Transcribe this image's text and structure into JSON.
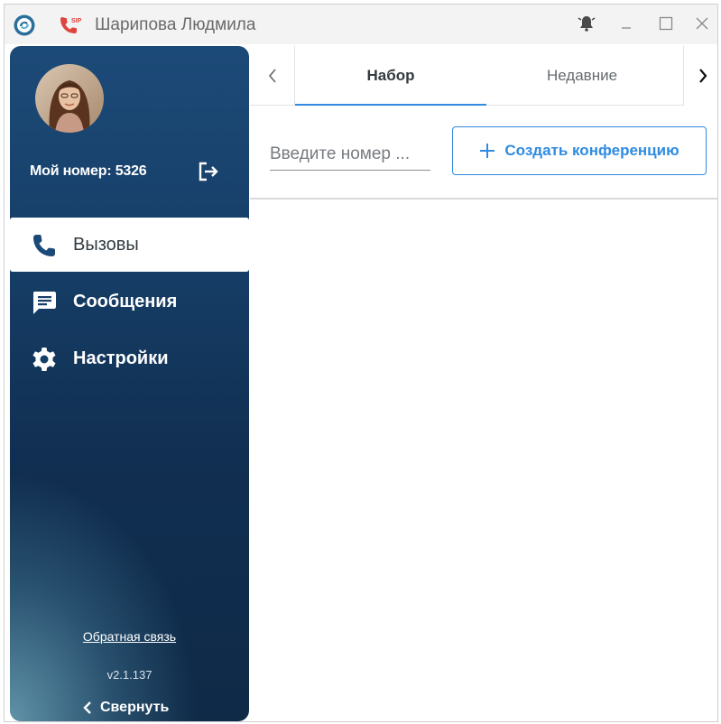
{
  "window": {
    "title": "Шарипова Людмила",
    "icons": [
      "app-logo-icon",
      "sip-phone-icon",
      "bell-icon",
      "minimize-icon",
      "maximize-icon",
      "close-icon"
    ]
  },
  "sidebar": {
    "my_number_label": "Мой номер: 5326",
    "items": [
      {
        "label": "Вызовы",
        "icon": "phone-icon",
        "active": true
      },
      {
        "label": "Сообщения",
        "icon": "message-icon",
        "active": false
      },
      {
        "label": "Настройки",
        "icon": "gear-icon",
        "active": false
      }
    ],
    "feedback_label": "Обратная связь",
    "version": "v2.1.137",
    "collapse_label": "Свернуть"
  },
  "tabs": {
    "items": [
      {
        "label": "Набор",
        "active": true
      },
      {
        "label": "Недавние",
        "active": false
      }
    ]
  },
  "toolbar": {
    "number_placeholder": "Введите номер ...",
    "number_value": "",
    "conference_button_label": "Создать конференцию"
  },
  "colors": {
    "accent": "#2f8be0",
    "sidebar_dark": "#0f2a47",
    "sidebar_mid": "#1c4a78",
    "sip_red": "#e0443e"
  }
}
